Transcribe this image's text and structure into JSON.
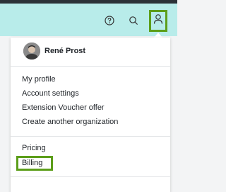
{
  "header": {
    "icons": [
      "help-icon",
      "search-icon",
      "user-icon"
    ]
  },
  "profile": {
    "name": "René Prost"
  },
  "menu": {
    "account": [
      {
        "label": "My profile"
      },
      {
        "label": "Account settings"
      },
      {
        "label": "Extension Voucher offer"
      },
      {
        "label": "Create another organization"
      }
    ],
    "billing": [
      {
        "label": "Pricing"
      },
      {
        "label": "Billing"
      }
    ]
  },
  "colors": {
    "header_bg": "#b8ecea",
    "highlight": "#5c9e1a"
  }
}
